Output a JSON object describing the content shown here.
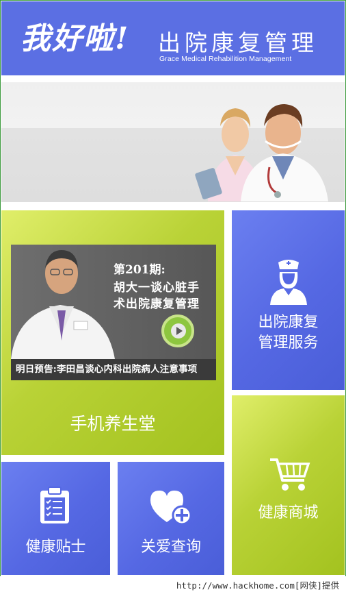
{
  "header": {
    "slogan": "我好啦!",
    "title": "出院康复管理",
    "subtitle": "Grace Medical Rehabilition Management",
    "background_color": "#5b6fe3"
  },
  "banner": {
    "image": "doctor-and-nurse-photo"
  },
  "tiles": {
    "phone_health": {
      "label": "手机养生堂",
      "video": {
        "episode": "第201期:",
        "line1": "胡大一谈心脏手",
        "line2": "术出院康复管理",
        "preview": "明日预告:李田昌谈心内科出院病人注意事项",
        "play_icon": "play-icon"
      },
      "color": "#b9d236"
    },
    "service": {
      "label_line1": "出院康复",
      "label_line2": "管理服务",
      "icon": "nurse-icon",
      "color": "#5568e3"
    },
    "shop": {
      "label": "健康商城",
      "icon": "shopping-cart-icon",
      "color": "#b9d236"
    },
    "tips": {
      "label": "健康贴士",
      "icon": "clipboard-icon",
      "color": "#5568e3"
    },
    "care": {
      "label": "关爱查询",
      "icon": "heart-plus-icon",
      "color": "#5568e3"
    }
  },
  "watermark": {
    "text": "http://www.hackhome.com[网侠]提供"
  }
}
